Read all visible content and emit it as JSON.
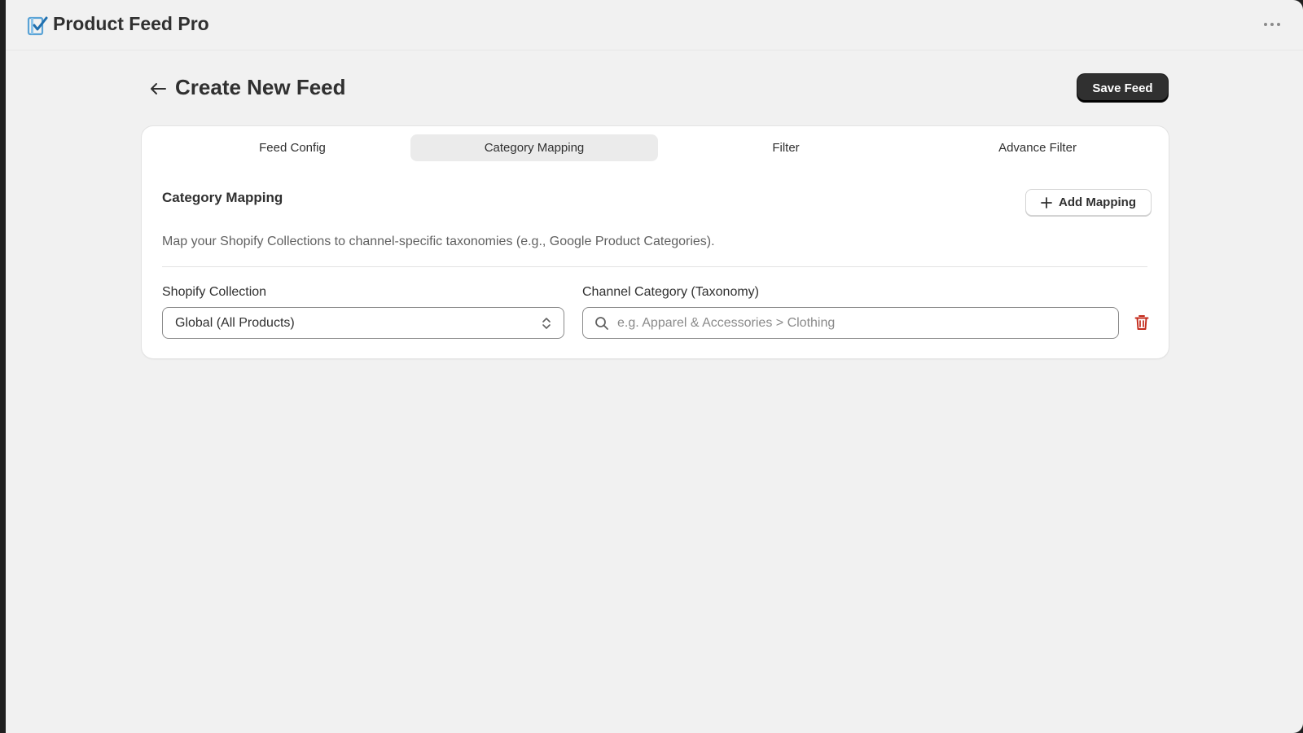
{
  "app": {
    "title": "Product Feed Pro",
    "logo_icon": "checklist-logo-icon",
    "more_icon": "ellipsis-icon"
  },
  "page": {
    "title": "Create New Feed",
    "back_icon": "arrow-left-icon",
    "save_label": "Save Feed"
  },
  "tabs": [
    {
      "label": "Feed Config",
      "active": false
    },
    {
      "label": "Category Mapping",
      "active": true
    },
    {
      "label": "Filter",
      "active": false
    },
    {
      "label": "Advance Filter",
      "active": false
    }
  ],
  "section": {
    "title": "Category Mapping",
    "add_label": "Add Mapping",
    "description": "Map your Shopify Collections to channel-specific taxonomies (e.g., Google Product Categories)."
  },
  "mapping": {
    "collection_label": "Shopify Collection",
    "collection_value": "Global (All Products)",
    "category_label": "Channel Category (Taxonomy)",
    "category_value": "",
    "category_placeholder": "e.g. Apparel & Accessories > Clothing"
  },
  "colors": {
    "accent_dark": "#303030",
    "delete": "#c42b1c",
    "logo_blue": "#2f7fbf"
  }
}
